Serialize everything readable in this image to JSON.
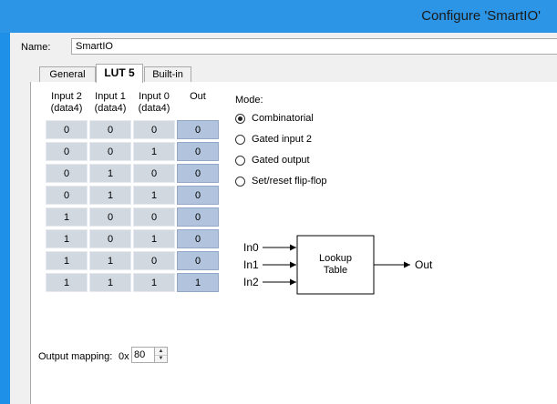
{
  "window": {
    "title": "Configure 'SmartIO'"
  },
  "name_field": {
    "label": "Name:",
    "value": "SmartIO"
  },
  "tabs": [
    {
      "label": "General",
      "active": false
    },
    {
      "label": "LUT 5",
      "active": true
    },
    {
      "label": "Built-in",
      "active": false
    }
  ],
  "truth_table": {
    "headers": [
      {
        "line1": "Input 2",
        "line2": "(data4)"
      },
      {
        "line1": "Input 1",
        "line2": "(data4)"
      },
      {
        "line1": "Input 0",
        "line2": "(data4)"
      },
      {
        "line1": "Out",
        "line2": ""
      }
    ],
    "rows": [
      [
        "0",
        "0",
        "0",
        "0"
      ],
      [
        "0",
        "0",
        "1",
        "0"
      ],
      [
        "0",
        "1",
        "0",
        "0"
      ],
      [
        "0",
        "1",
        "1",
        "0"
      ],
      [
        "1",
        "0",
        "0",
        "0"
      ],
      [
        "1",
        "0",
        "1",
        "0"
      ],
      [
        "1",
        "1",
        "0",
        "0"
      ],
      [
        "1",
        "1",
        "1",
        "1"
      ]
    ]
  },
  "output_mapping": {
    "label": "Output mapping:",
    "prefix": "0x",
    "value": "80"
  },
  "mode": {
    "label": "Mode:",
    "options": [
      {
        "label": "Combinatorial",
        "selected": true
      },
      {
        "label": "Gated input 2",
        "selected": false
      },
      {
        "label": "Gated output",
        "selected": false
      },
      {
        "label": "Set/reset flip-flop",
        "selected": false
      }
    ]
  },
  "diagram": {
    "inputs": [
      "In0",
      "In1",
      "In2"
    ],
    "block_line1": "Lookup",
    "block_line2": "Table",
    "output": "Out"
  }
}
